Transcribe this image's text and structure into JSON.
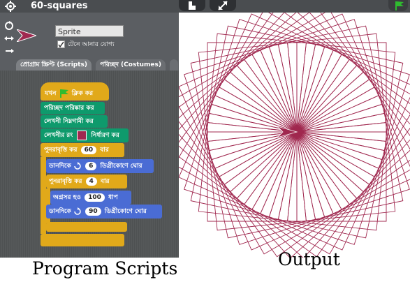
{
  "project": {
    "title": "60-squares"
  },
  "sprite": {
    "name": "Sprite",
    "draggable_label": "টেনে আনার যোগ্য"
  },
  "tabs": {
    "scripts": "প্রোগ্রাম স্ক্রিপ্ট (Scripts)",
    "costumes": "পরিচ্ছদ (Costumes)"
  },
  "blocks": {
    "when_flag": "যখন",
    "when_flag_suffix": "ক্লিক কর",
    "clear": "পরিচ্ছদ পরিষ্কার কর",
    "pen_down": "লেখনী নিম্নগামী কর",
    "set_color": "লেখনীর রং",
    "set_color_suffix": "নির্ধারণ কর",
    "repeat_outer": "পুনরাবৃত্তি কর",
    "repeat_outer_count": "60",
    "repeat_outer_suffix": "বার",
    "turn_right_1": "ডানদিকে",
    "turn_right_1_deg": "6",
    "turn_right_1_suffix": "ডিগ্রীকোণে ঘোর",
    "repeat_inner": "পুনরাবৃত্তি কর",
    "repeat_inner_count": "4",
    "repeat_inner_suffix": "বার",
    "move": "অগ্রসর হও",
    "move_steps": "100",
    "move_suffix": "ধাপ",
    "turn_right_2": "ডানদিকে",
    "turn_right_2_deg": "90",
    "turn_right_2_suffix": "ডিগ্রীকোণে ঘোর"
  },
  "captions": {
    "left": "Program Scripts",
    "right": "Output"
  },
  "colors": {
    "pen": "#a0284f",
    "motion": "#4a6cd4",
    "control": "#e1a91a",
    "pen_block": "#0e9a6c",
    "flag": "#2fbb2f"
  }
}
